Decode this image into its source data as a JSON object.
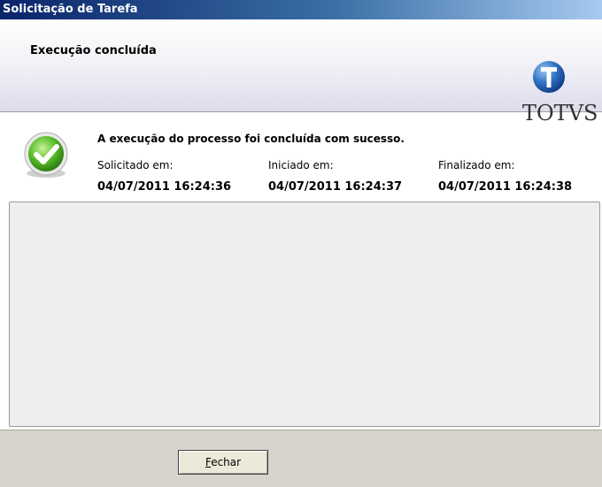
{
  "window": {
    "title": "Solicitação de Tarefa"
  },
  "header": {
    "title": "Execução concluída",
    "logo_text": "TOTVS"
  },
  "status": {
    "icon": "check-circle-icon",
    "message": "A execução do processo foi concluída com sucesso."
  },
  "times": [
    {
      "label": "Solicitado em:",
      "value": "04/07/2011 16:24:36"
    },
    {
      "label": "Iniciado em:",
      "value": "04/07/2011 16:24:37"
    },
    {
      "label": "Finalizado em:",
      "value": "04/07/2011 16:24:38"
    }
  ],
  "footer": {
    "close_button_mnemonic": "F",
    "close_button_rest": "echar"
  },
  "colors": {
    "success_green": "#5bbf2a",
    "logo_blue": "#2f74c6"
  }
}
